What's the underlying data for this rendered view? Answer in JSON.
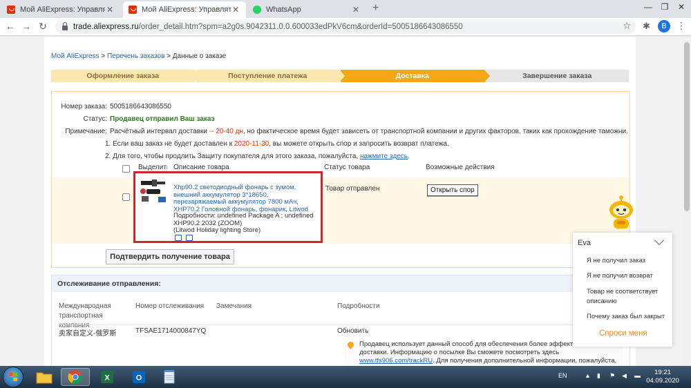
{
  "browser": {
    "tabs": [
      {
        "title": "Мой AliExpress: Управлять зака"
      },
      {
        "title": "Мой AliExpress: Управлять зака"
      },
      {
        "title": "WhatsApp"
      }
    ],
    "new_tab": "+",
    "window": {
      "minimize": "—",
      "maximize": "❐",
      "close": "✕"
    },
    "url_host": "trade.aliexpress.ru",
    "url_path": "/order_detail.htm?spm=a2g0s.9042311.0.0.600033edPkV6cm&orderId=5005186643086550",
    "profile_initial": "B"
  },
  "breadcrumb": {
    "home": "Мой AliExpress",
    "sep1": " > ",
    "orders": "Перечень заказов",
    "sep2": " > ",
    "current": "Данные о заказе"
  },
  "steps": [
    {
      "label": "Оформление заказа"
    },
    {
      "label": "Поступление платежа"
    },
    {
      "label": "Доставка"
    },
    {
      "label": "Завершение заказа"
    }
  ],
  "order": {
    "number_label": "Номер заказа:",
    "number": "5005186643086550",
    "status_label": "Статус:",
    "status": "Продавец отправил Ваш заказ",
    "note_label": "Примечание:",
    "note_pre": "Расчётный интервал доставки",
    "note_days": "-- 20-40 дн",
    "note_post": ", но фактическое время будет зависеть от транспортной компании и других факторов, таких как прохождение таможни.",
    "note1_pre": "1. Если ваш заказ не будет доставлен к",
    "note1_date": "2020-11-30",
    "note1_post": ", вы можете открыть спор и запросить возврат платежа.",
    "note2_pre": "2. Для того, чтобы продлить Защиту покупателя для этого заказа, пожалуйста,",
    "note2_link": "нажмите здесь",
    "note2_post": "."
  },
  "table": {
    "col_select": "Выделить все",
    "col_desc": "Описание товара",
    "col_status": "Статус товара",
    "col_actions": "Возможные действия"
  },
  "product": {
    "title": "Xhp90.2 светодиодный фонарь с зумом, внешний аккумулятор 3*18650, перезаряжаемый аккумулятор 7800 мАч, XHP70.2 Головной фонарь, фонарик, Litwod",
    "details": "Подробности: undefined Package A ; undefined XHP90.2 2032 (ZOOM)",
    "store": "(Litwod Holiday lighting Store)",
    "status": "Товар отправлен",
    "dispute_button": "Открыть спор"
  },
  "confirm_button": "Подтвердить получение товара",
  "tracking": {
    "header": "Отслеживание отправления:",
    "col_company": "Международная транспортная компания",
    "col_number": "Номер отслеживания",
    "col_remarks": "Замечания",
    "col_details": "Подробности",
    "company": "卖家自定义-俄罗斯",
    "number": "TFSAE1714000847YQ",
    "refresh": "Обновить",
    "info_pre": "Продавец использует данный способ для обеспечения более эффективной доставки. Информацию о посылке Вы сможете посмотреть здесь",
    "info_link": "www.tfs906.com/trackRU",
    "info_post": ". Для получения дополнительной информации, пожалуйста, свяжитесь с продавцом."
  },
  "eva": {
    "title": "Eva",
    "items": [
      "Я не получил заказ",
      "Я не получил возврат",
      "Товар не соответствует описанию",
      "Почему заказ был закрыт"
    ],
    "ask": "Спроси меня"
  },
  "taskbar": {
    "lang": "EN",
    "time": "19:21",
    "date": "04.09.2020"
  },
  "colors": {
    "accent": "#f8a616",
    "status_green": "#2f7a1f",
    "link": "#2a65b4",
    "highlight_red": "#d0262b"
  }
}
